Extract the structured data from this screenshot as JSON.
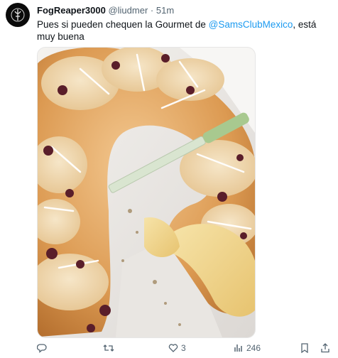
{
  "tweet": {
    "author_name": "FogReaper3000",
    "handle": "@liudmer",
    "separator": "·",
    "time": "51m",
    "text_before": "Pues si pueden chequen la Gourmet de ",
    "mention": "@SamsClubMexico",
    "text_after": ", está muy buena"
  },
  "media": {
    "subject": "rosca-de-reyes-photo"
  },
  "actions": {
    "reply_count": "",
    "retweet_count": "",
    "like_count": "3",
    "views_count": "246"
  },
  "colors": {
    "accent": "#1d9bf0",
    "muted": "#536471",
    "text": "#0f1419"
  },
  "icons": [
    "reply-icon",
    "retweet-icon",
    "like-icon",
    "views-icon",
    "bookmark-icon",
    "share-icon"
  ]
}
